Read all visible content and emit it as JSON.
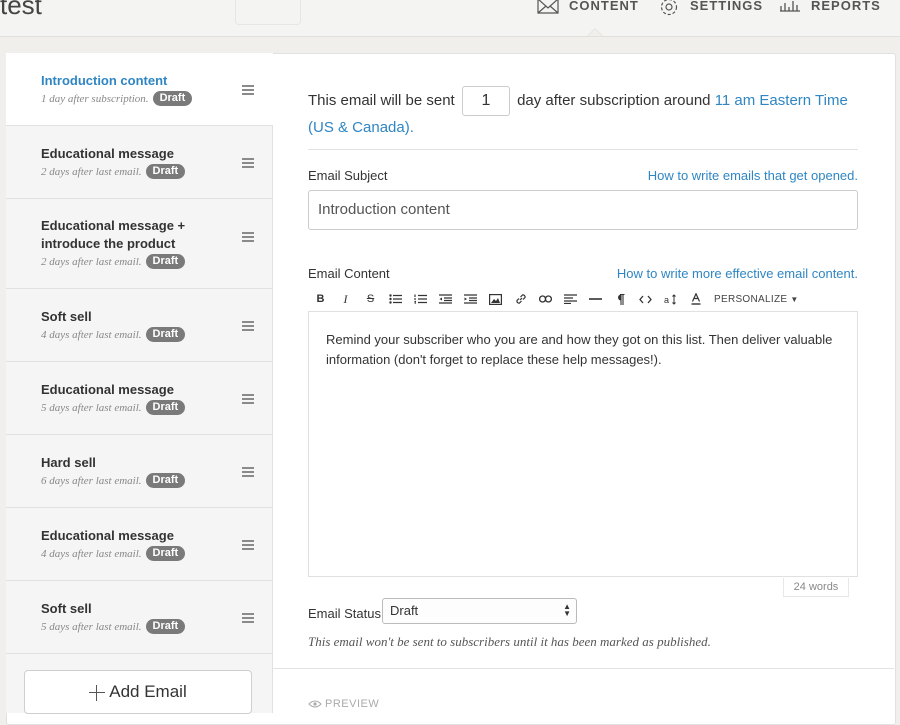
{
  "app": {
    "title": "test"
  },
  "nav": [
    {
      "label": "CONTENT",
      "icon": "envelope-icon"
    },
    {
      "label": "SETTINGS",
      "icon": "gear-icon"
    },
    {
      "label": "REPORTS",
      "icon": "bar-chart-icon"
    }
  ],
  "sidebar": {
    "items": [
      {
        "title": "Introduction content",
        "meta": "1 day after subscription.",
        "badge": "Draft",
        "active": true
      },
      {
        "title": "Educational message",
        "meta": "2 days after last email.",
        "badge": "Draft"
      },
      {
        "title": "Educational message + introduce the product",
        "meta": "2 days after last email.",
        "badge": "Draft"
      },
      {
        "title": "Soft sell",
        "meta": "4 days after last email.",
        "badge": "Draft"
      },
      {
        "title": "Educational message",
        "meta": "5 days after last email.",
        "badge": "Draft"
      },
      {
        "title": "Hard sell",
        "meta": "6 days after last email.",
        "badge": "Draft"
      },
      {
        "title": "Educational message",
        "meta": "4 days after last email.",
        "badge": "Draft"
      },
      {
        "title": "Soft sell",
        "meta": "5 days after last email.",
        "badge": "Draft"
      }
    ],
    "add_label": "Add Email"
  },
  "schedule": {
    "prefix": "This email will be sent",
    "days_value": "1",
    "middle": "day after subscription around",
    "time_link": "11 am Eastern Time (US & Canada)."
  },
  "subject": {
    "label": "Email Subject",
    "help_link": "How to write emails that get opened.",
    "value": "Introduction content"
  },
  "content": {
    "label": "Email Content",
    "help_link": "How to write more effective email content.",
    "body": "Remind your subscriber who you are and how they got on this list. Then deliver valuable information (don't forget to replace these help messages!).",
    "word_count": "24 words"
  },
  "toolbar": {
    "bold": "B",
    "italic": "I",
    "strike": "S",
    "personalize": "PERSONALIZE"
  },
  "status": {
    "label": "Email Status",
    "value": "Draft",
    "note": "This email won't be sent to subscribers until it has been marked as published."
  },
  "footer": {
    "preview": "PREVIEW"
  },
  "colors": {
    "accent": "#2f86c3",
    "badge": "#7a7a7a"
  }
}
